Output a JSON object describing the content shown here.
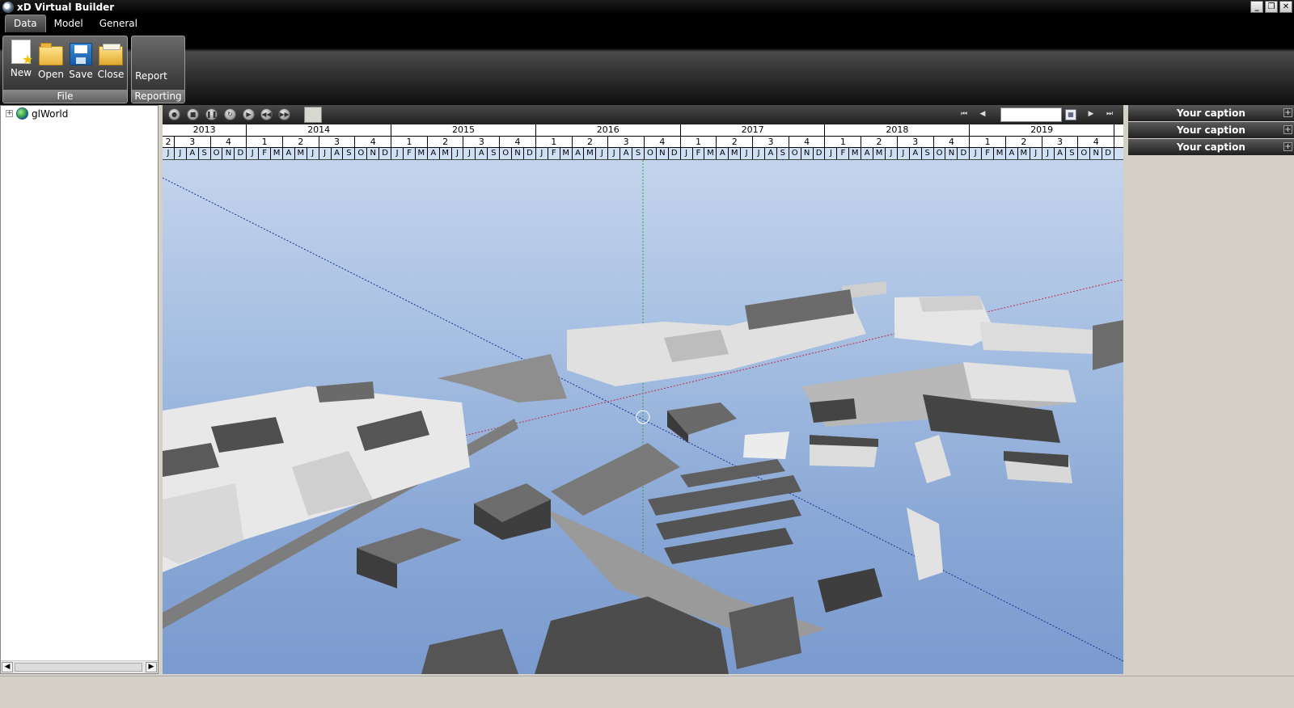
{
  "window": {
    "title": "xD Virtual Builder",
    "controls": [
      "_",
      "❐",
      "✕"
    ]
  },
  "ribbon_tabs": [
    {
      "label": "Data",
      "active": true
    },
    {
      "label": "Model",
      "active": false
    },
    {
      "label": "General",
      "active": false
    }
  ],
  "ribbon": {
    "file_group": {
      "label": "File",
      "buttons": [
        {
          "label": "New",
          "icon": "new-document-icon"
        },
        {
          "label": "Open",
          "icon": "open-folder-icon"
        },
        {
          "label": "Save",
          "icon": "save-disk-icon"
        },
        {
          "label": "Close",
          "icon": "close-folder-icon"
        }
      ]
    },
    "reporting_group": {
      "label": "Reporting",
      "buttons": [
        {
          "label": "Report"
        }
      ]
    }
  },
  "tree": {
    "items": [
      {
        "label": "glWorld",
        "icon": "globe-icon",
        "expanded": false
      }
    ]
  },
  "timeline": {
    "years": [
      {
        "label": "2013"
      },
      {
        "label": "2014"
      },
      {
        "label": "2015"
      },
      {
        "label": "2016"
      },
      {
        "label": "2017"
      },
      {
        "label": "2018"
      },
      {
        "label": "2019"
      }
    ],
    "quarters_first": [
      "2",
      "3",
      "4"
    ],
    "quarters": [
      "1",
      "2",
      "3",
      "4"
    ],
    "months_first": [
      "J",
      "J",
      "A",
      "S",
      "O",
      "N",
      "D"
    ],
    "months": [
      "J",
      "F",
      "M",
      "A",
      "M",
      "J",
      "J",
      "A",
      "S",
      "O",
      "N",
      "D"
    ],
    "date_value": ""
  },
  "right_panel": {
    "captions": [
      "Your caption",
      "Your caption",
      "Your caption"
    ]
  },
  "colors": {
    "accent": "#000000",
    "sky_top": "#c4d4ec",
    "sky_bottom": "#7b9bcf",
    "building_light": "#e6e6e6",
    "building_dark": "#4a4a4a"
  }
}
